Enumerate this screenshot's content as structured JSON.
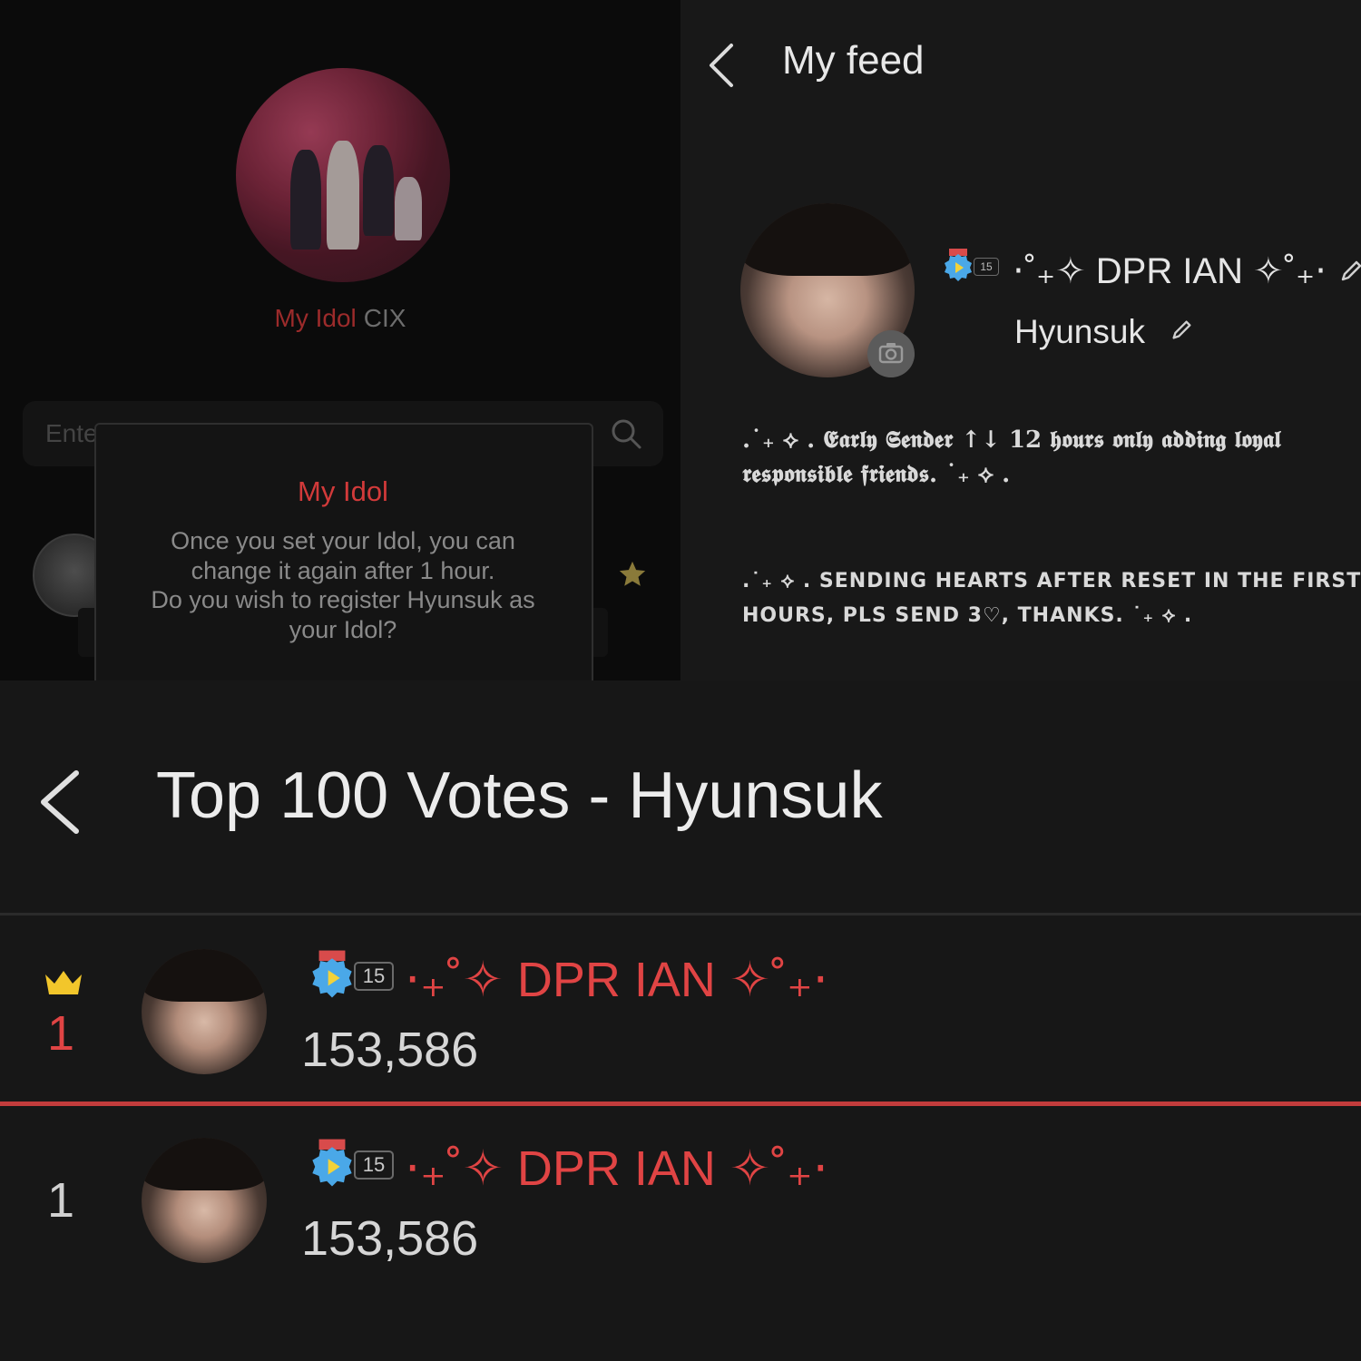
{
  "idol_panel": {
    "my_idol_label": "My Idol",
    "current_idol": "CIX",
    "search_placeholder": "Ente",
    "dialog": {
      "title": "My Idol",
      "body_lines": [
        "Once you set your Idol, you can",
        "change it again after 1 hour.",
        "Do you wish to register Hyunsuk as",
        "your Idol?"
      ]
    }
  },
  "feed_panel": {
    "title": "My feed",
    "level": "15",
    "nickname": "⋅˚₊✧ DPR IAN ✧˚₊⋅",
    "idol_name": "Hyunsuk",
    "bio_line_1": ".˙₊ ⟡ . 𝕰𝖆𝖗𝖑𝖞 𝕾𝖊𝖓𝖉𝖊𝖗 ↑↓ 12 𝖍𝖔𝖚𝖗𝖘 𝖔𝖓𝖑𝖞 𝖆𝖉𝖉𝖎𝖓𝖌 𝖑𝖔𝖞𝖆𝖑",
    "bio_line_2": "𝖗𝖊𝖘𝖕𝖔𝖓𝖘𝖎𝖇𝖑𝖊 𝖋𝖗𝖎𝖊𝖓𝖉𝖘. ˙₊ ⟡ .",
    "status_line_1": ".˙₊ ⟡ . SENDING HEARTS AFTER RESET IN THE FIRST",
    "status_line_2": "HOURS, PLS SEND 3♡, THANKS. ˙₊ ⟡ ."
  },
  "votes_panel": {
    "title": "Top 100 Votes - Hyunsuk",
    "rows": [
      {
        "rank": "1",
        "level": "15",
        "name": "⋅₊˚✧ DPR IAN ✧˚₊⋅",
        "votes": "153,586",
        "highlight": true
      },
      {
        "rank": "1",
        "level": "15",
        "name": "⋅₊˚✧ DPR IAN ✧˚₊⋅",
        "votes": "153,586",
        "highlight": false
      }
    ]
  },
  "colors": {
    "accent_red": "#e04444",
    "crown_gold": "#f2c62b",
    "background": "#171717"
  },
  "icons": [
    "back-chevron-icon",
    "search-icon",
    "star-icon",
    "camera-icon",
    "pencil-icon",
    "crown-icon",
    "level-badge-icon"
  ]
}
